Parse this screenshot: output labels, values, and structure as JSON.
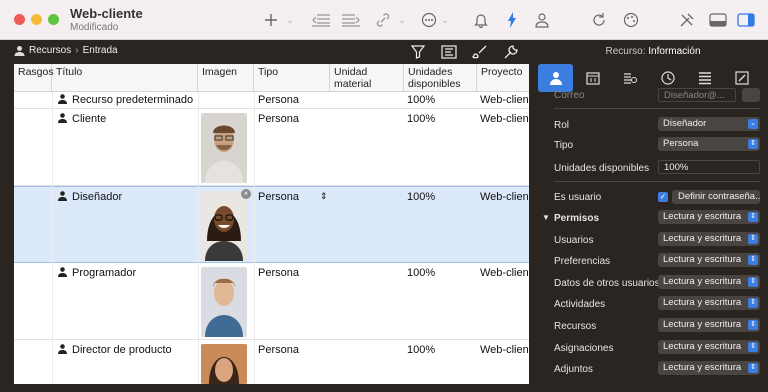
{
  "window": {
    "title": "Web-cliente",
    "subtitle": "Modificado"
  },
  "breadcrumb": {
    "root": "Recursos",
    "current": "Entrada"
  },
  "columns": [
    "Rasgos",
    "Título",
    "Imagen",
    "Tipo",
    "Unidad material",
    "Unidades disponibles",
    "Proyecto"
  ],
  "rows": [
    {
      "name": "Recurso predeterminado",
      "type": "Persona",
      "units": "100%",
      "project": "Web-cliente"
    },
    {
      "name": "Cliente",
      "type": "Persona",
      "units": "100%",
      "project": "Web-cliente"
    },
    {
      "name": "Diseñador",
      "type": "Persona",
      "units": "100%",
      "project": "Web-cliente"
    },
    {
      "name": "Programador",
      "type": "Persona",
      "units": "100%",
      "project": "Web-cliente"
    },
    {
      "name": "Director de producto",
      "type": "Persona",
      "units": "100%",
      "project": "Web-cliente"
    }
  ],
  "inspector": {
    "title_prefix": "Recurso:",
    "title": "Información",
    "partial_label": "Correo",
    "partial_value": "Diseñador@...",
    "fields": [
      {
        "label": "Rol",
        "value": "Diseñador"
      },
      {
        "label": "Tipo",
        "value": "Persona"
      },
      {
        "label": "Unidades disponibles",
        "value": "100%"
      }
    ],
    "is_user_label": "Es usuario",
    "set_password": "Definir contraseña...",
    "permissions_label": "Permisos",
    "permissions_value": "Lectura y escritura",
    "permissions": [
      {
        "label": "Usuarios",
        "value": "Lectura y escritura"
      },
      {
        "label": "Preferencias",
        "value": "Lectura y escritura"
      },
      {
        "label": "Datos de otros usuarios",
        "value": "Lectura y escritura"
      },
      {
        "label": "Actividades",
        "value": "Lectura y escritura"
      },
      {
        "label": "Recursos",
        "value": "Lectura y escritura"
      },
      {
        "label": "Asignaciones",
        "value": "Lectura y escritura"
      },
      {
        "label": "Adjuntos",
        "value": "Lectura y escritura"
      }
    ]
  }
}
